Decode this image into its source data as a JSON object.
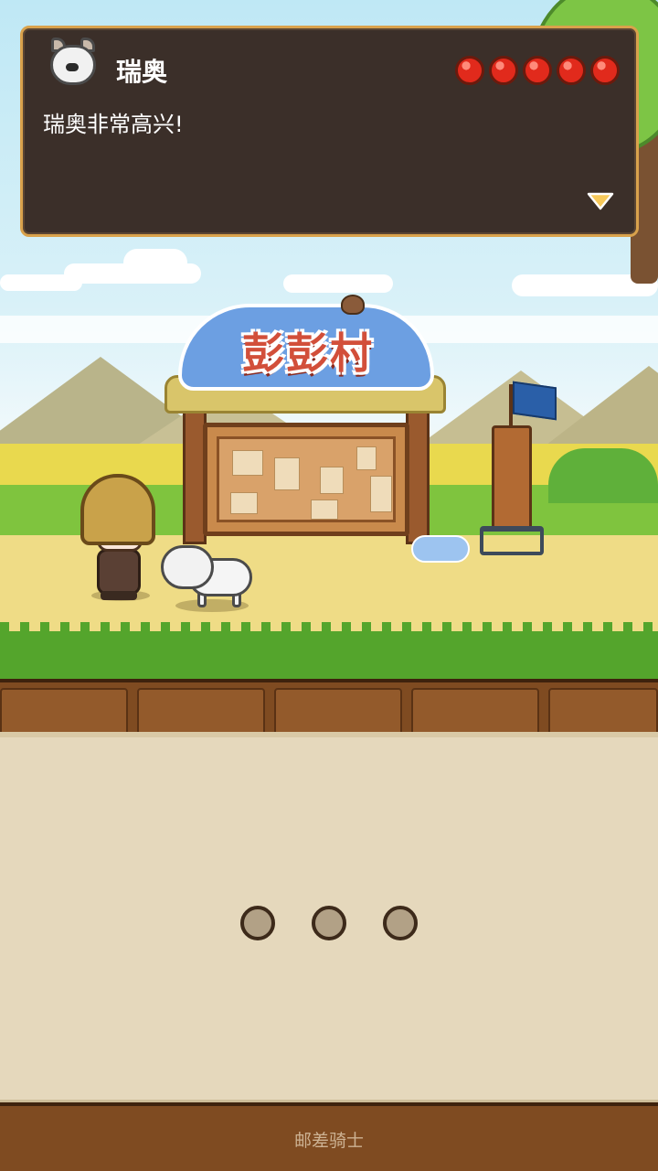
{
  "dialog": {
    "speaker": "瑞奥",
    "message": "瑞奥非常高兴!",
    "hearts": [
      "heart",
      "heart",
      "heart",
      "heart",
      "heart"
    ],
    "portrait_icon": "husky-dog-portrait",
    "next_icon": "triangle-down-icon"
  },
  "scene": {
    "village_sign": "彭彭村"
  },
  "pager": {
    "dots": [
      "page-dot",
      "page-dot",
      "page-dot"
    ]
  },
  "footer": {
    "app_name": "邮差骑士"
  },
  "colors": {
    "dialog_bg": "#3b2f29",
    "dialog_border": "#d9a24c",
    "heart": "#e12a1c",
    "sign_text": "#d24f3a",
    "parchment": "#e5d8bc",
    "wood": "#7f4b21"
  }
}
